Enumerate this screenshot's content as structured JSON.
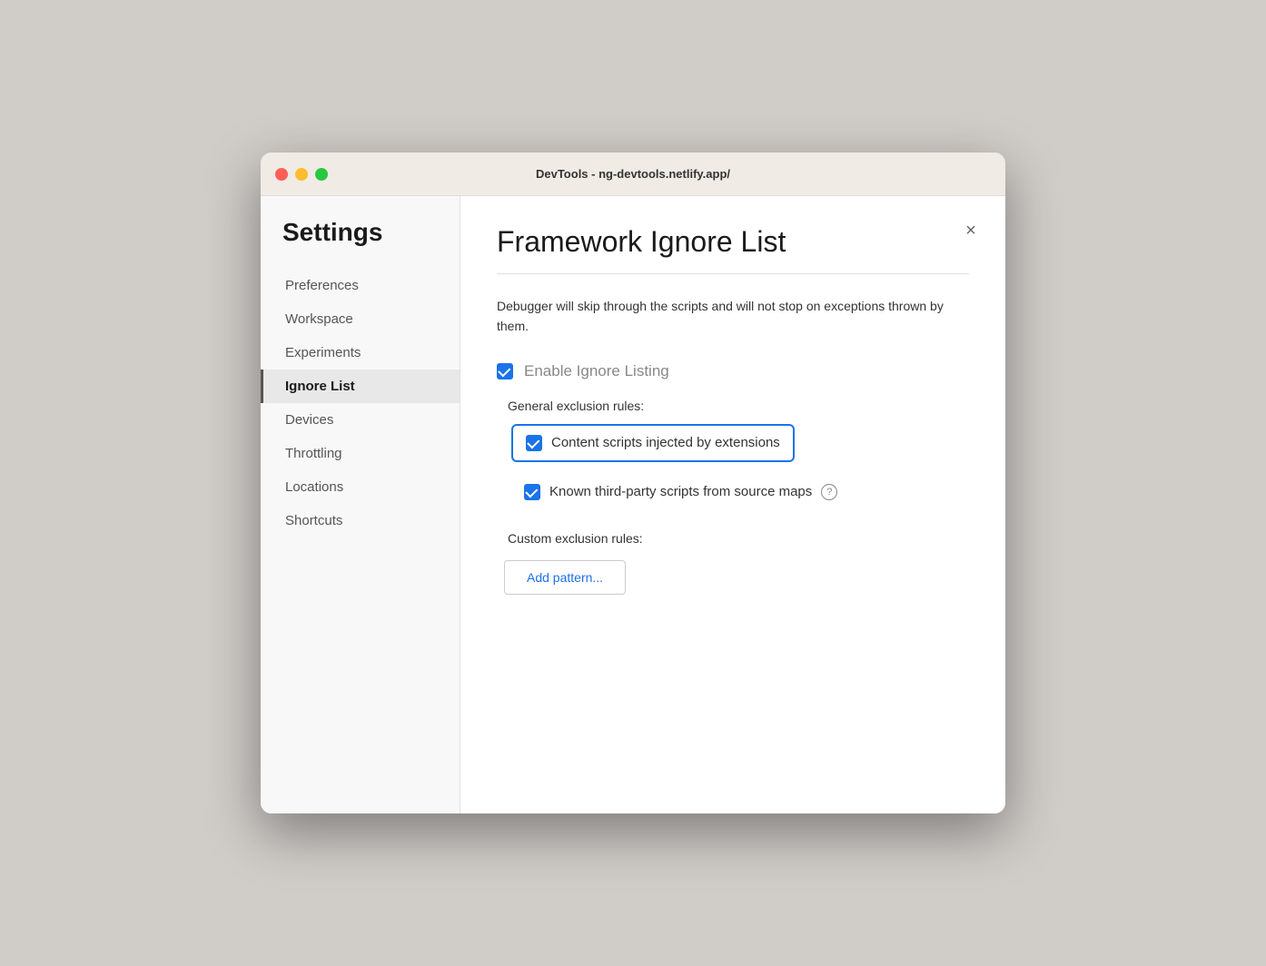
{
  "titlebar": {
    "title": "DevTools - ng-devtools.netlify.app/"
  },
  "sidebar": {
    "heading": "Settings",
    "items": [
      {
        "id": "preferences",
        "label": "Preferences",
        "active": false
      },
      {
        "id": "workspace",
        "label": "Workspace",
        "active": false
      },
      {
        "id": "experiments",
        "label": "Experiments",
        "active": false
      },
      {
        "id": "ignore-list",
        "label": "Ignore List",
        "active": true
      },
      {
        "id": "devices",
        "label": "Devices",
        "active": false
      },
      {
        "id": "throttling",
        "label": "Throttling",
        "active": false
      },
      {
        "id": "locations",
        "label": "Locations",
        "active": false
      },
      {
        "id": "shortcuts",
        "label": "Shortcuts",
        "active": false
      }
    ]
  },
  "main": {
    "title": "Framework Ignore List",
    "description": "Debugger will skip through the scripts and will not stop on exceptions thrown by them.",
    "enable_checkbox_label": "Enable Ignore Listing",
    "general_section_label": "General exclusion rules:",
    "rules": [
      {
        "id": "content-scripts",
        "label": "Content scripts injected by extensions",
        "checked": true,
        "highlighted": true,
        "has_help": false
      },
      {
        "id": "third-party-scripts",
        "label": "Known third-party scripts from source maps",
        "checked": true,
        "highlighted": false,
        "has_help": true
      }
    ],
    "custom_section_label": "Custom exclusion rules:",
    "add_pattern_button": "Add pattern...",
    "close_icon": "×"
  }
}
